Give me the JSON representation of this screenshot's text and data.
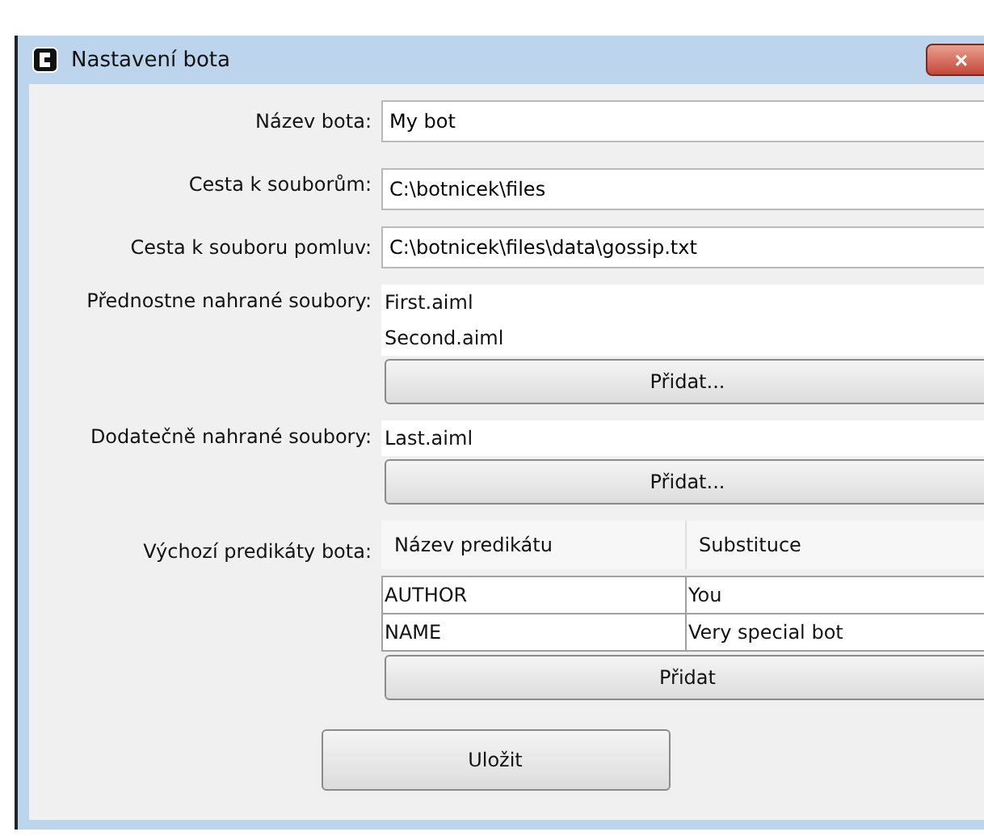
{
  "window": {
    "title": "Nastavení bota",
    "close": "×"
  },
  "fields": [
    {
      "label": "Název bota:",
      "value": "My bot"
    },
    {
      "label": "Cesta k souborům:",
      "value": "C:\\botnicek\\files"
    },
    {
      "label": "Cesta k souboru pomluv:",
      "value": "C:\\botnicek\\files\\data\\gossip.txt"
    }
  ],
  "file_lists": [
    {
      "label": "Přednostne nahrané soubory:",
      "items": [
        "First.aiml",
        "Second.aiml"
      ],
      "button": "Přidat..."
    },
    {
      "label": "Dodatečně nahrané soubory:",
      "items": [
        "Last.aiml"
      ],
      "button": "Přidat..."
    }
  ],
  "predicates": {
    "label": "Výchozí predikáty bota:",
    "columns": [
      "Název predikátu",
      "Substituce"
    ],
    "rows": [
      [
        "AUTHOR",
        "You"
      ],
      [
        "NAME",
        "Very special bot"
      ]
    ],
    "button": "Přidat"
  },
  "save_button": "Uložit"
}
